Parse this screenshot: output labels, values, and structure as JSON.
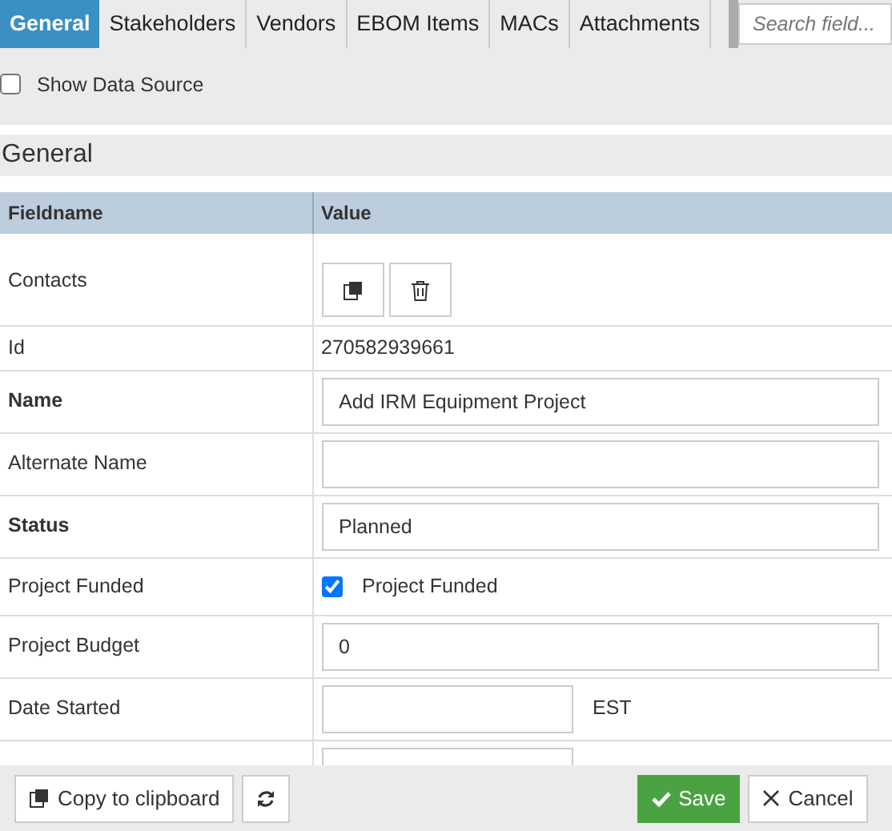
{
  "tabs": [
    {
      "label": "General",
      "selected": true
    },
    {
      "label": "Stakeholders",
      "selected": false
    },
    {
      "label": "Vendors",
      "selected": false
    },
    {
      "label": "EBOM Items",
      "selected": false
    },
    {
      "label": "MACs",
      "selected": false
    },
    {
      "label": "Attachments",
      "selected": false
    }
  ],
  "search": {
    "placeholder": "Search field..."
  },
  "show_data_source": {
    "label": "Show Data Source",
    "checked": false
  },
  "section_title": "General",
  "table": {
    "columns": [
      "Fieldname",
      "Value"
    ],
    "rows": [
      {
        "kind": "buttons",
        "label": "Contacts",
        "required": false
      },
      {
        "kind": "text",
        "label": "Id",
        "required": false,
        "value": "270582939661"
      },
      {
        "kind": "input",
        "label": "Name",
        "required": true,
        "value": "Add IRM Equipment Project"
      },
      {
        "kind": "input",
        "label": "Alternate Name",
        "required": false,
        "value": ""
      },
      {
        "kind": "input",
        "label": "Status",
        "required": true,
        "value": "Planned"
      },
      {
        "kind": "checkbox",
        "label": "Project Funded",
        "required": false,
        "checked": true,
        "check_label": "Project Funded"
      },
      {
        "kind": "input",
        "label": "Project Budget",
        "required": false,
        "value": "0"
      },
      {
        "kind": "date",
        "label": "Date Started",
        "required": false,
        "value": "",
        "suffix": "EST"
      },
      {
        "kind": "date",
        "value": ""
      }
    ]
  },
  "footer": {
    "copy": "Copy to clipboard",
    "save": "Save",
    "cancel": "Cancel"
  }
}
